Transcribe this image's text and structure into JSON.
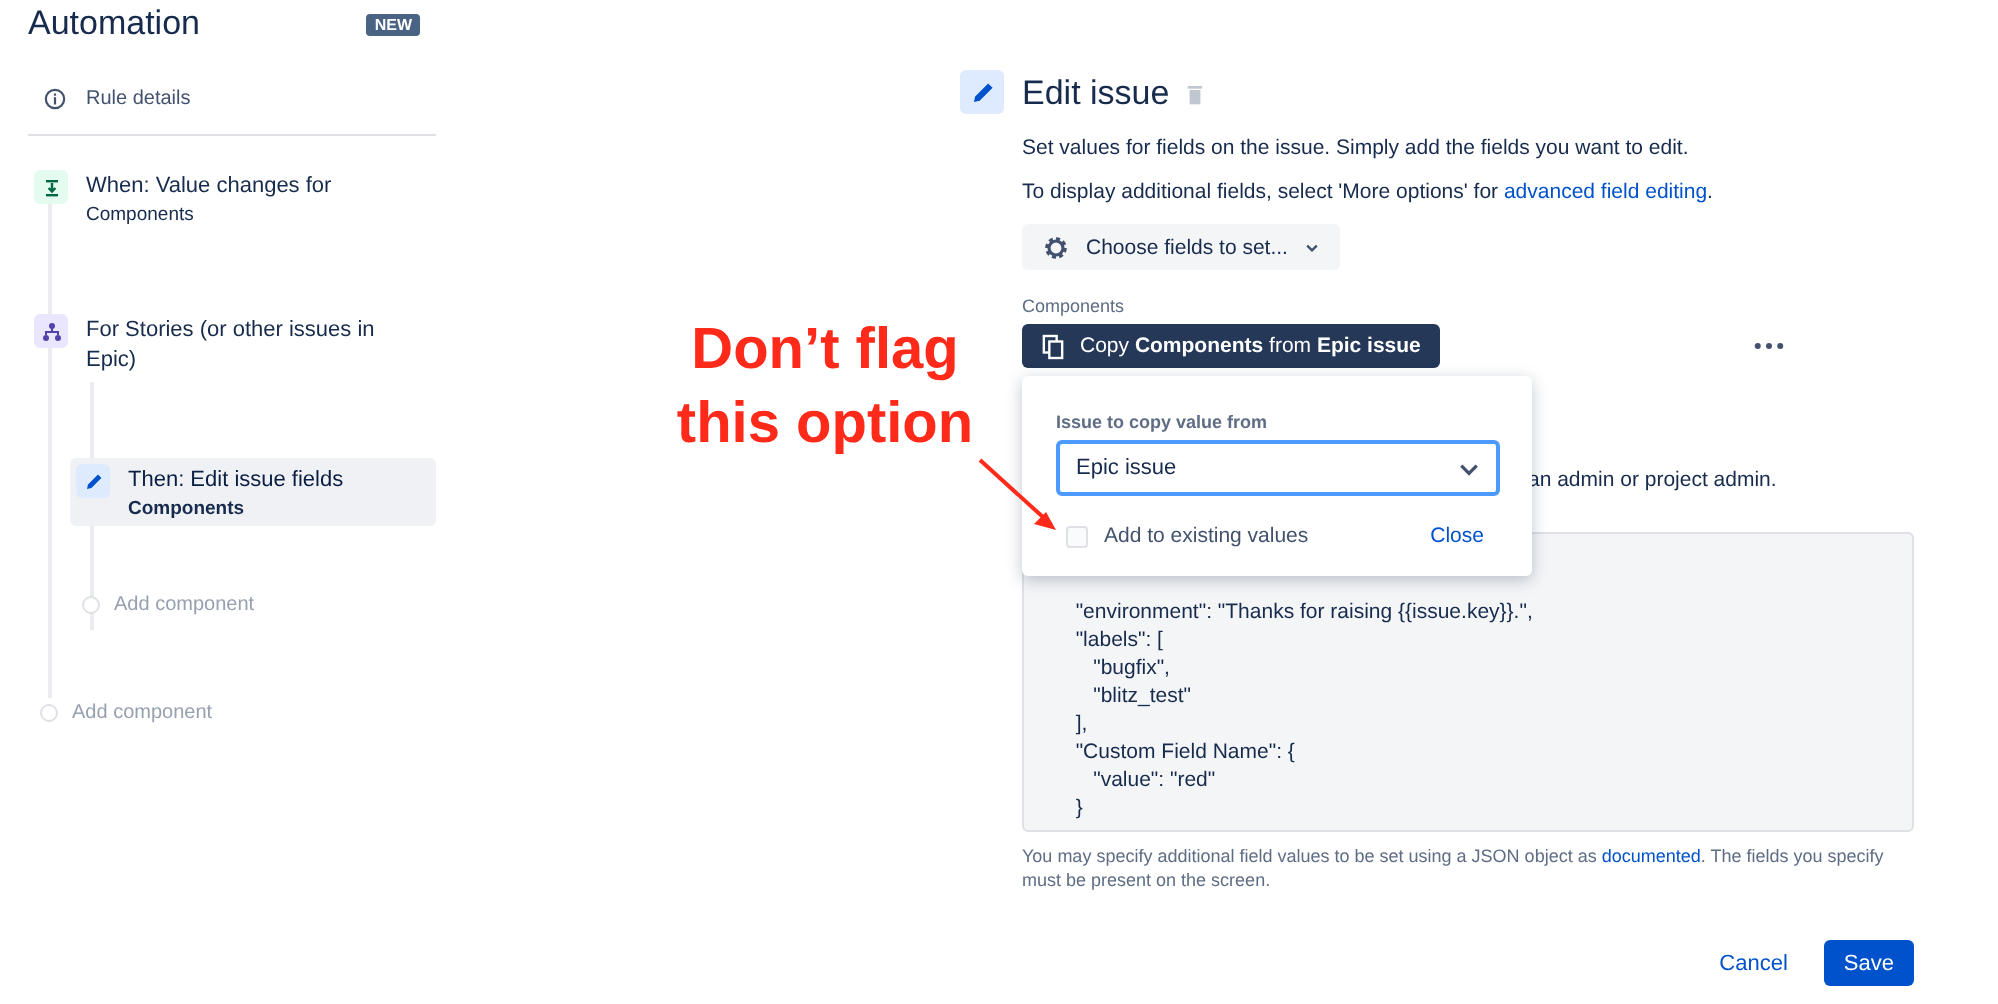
{
  "sidebar": {
    "title": "Automation",
    "badge": "NEW",
    "rule_details": "Rule details",
    "steps": [
      {
        "kind": "trigger",
        "title": "When: Value changes for",
        "subtitle": "Components",
        "selected": false
      },
      {
        "kind": "branch",
        "title": "For Stories (or other issues in Epic)",
        "selected": false,
        "children": [
          {
            "kind": "action",
            "title": "Then: Edit issue fields",
            "subtitle": "Components",
            "selected": true
          }
        ],
        "add_label": "Add component"
      }
    ],
    "add_label": "Add component"
  },
  "editor": {
    "title": "Edit issue",
    "description": "Set values for fields on the issue. Simply add the fields you want to edit.",
    "advanced_text": "To display additional fields, select 'More options' for ",
    "advanced_link": "advanced field editing",
    "advanced_end": ".",
    "choose_button": "Choose fields to set...",
    "field_label": "Components",
    "copy_button": "Copy **Components** from **Epic issue**",
    "popup": {
      "label": "Issue to copy value from",
      "select_value": "Epic issue",
      "checkbox": {
        "label": "Add to existing values",
        "checked": false
      },
      "close": "Close"
    },
    "notice": "an admin or project admin.",
    "code_lines": [
      "  \"environment\": \"Thanks for raising {{issue.key}}.\",",
      "  \"labels\": [",
      "     \"bugfix\",",
      "     \"blitz_test\"",
      "  ],",
      "  \"Custom Field Name\": {",
      "     \"value\": \"red\"",
      "  }"
    ],
    "help_text": "You may specify additional field values to be set using a JSON object as ",
    "help_link": "documented",
    "help_end": ". The fields you specify must be present on the screen.",
    "buttons": [
      {
        "label": "Cancel",
        "kind": "link"
      },
      {
        "label": "Save",
        "kind": "primary"
      }
    ]
  },
  "annotation": {
    "text": "Don’t flag this option"
  }
}
